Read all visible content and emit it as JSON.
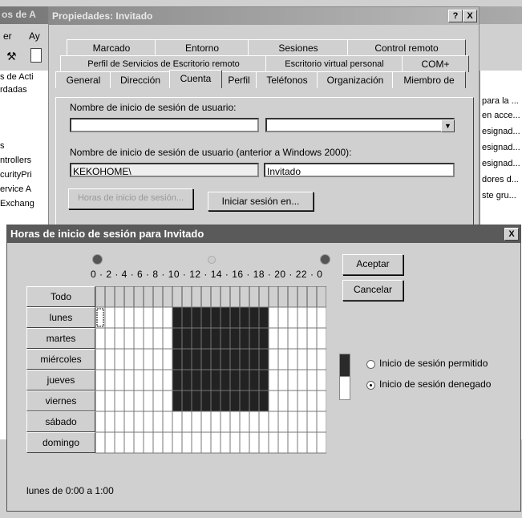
{
  "background_window": {
    "title": "os de A",
    "menu": [
      "er",
      "Ay"
    ],
    "left_items": [
      "s de Acti",
      "rdadas",
      "s",
      "ntrollers",
      "curityPri",
      "ervice A",
      "Exchang"
    ],
    "right_items": [
      "para la ...",
      "en acce...",
      "esignad...",
      "esignad...",
      "esignad...",
      "dores d...",
      "ste gru..."
    ]
  },
  "props_dialog": {
    "title": "Propiedades: Invitado",
    "help_btn": "?",
    "close_btn": "X",
    "tabs_row1": [
      "Marcado",
      "Entorno",
      "Sesiones",
      "Control remoto"
    ],
    "tabs_row2": [
      "Perfil de Servicios de Escritorio remoto",
      "Escritorio virtual personal",
      "COM+"
    ],
    "tabs_row3": [
      "General",
      "Dirección",
      "Cuenta",
      "Perfil",
      "Teléfonos",
      "Organización",
      "Miembro de"
    ],
    "selected_tab": "Cuenta",
    "logon_name_label": "Nombre de inicio de sesión de usuario:",
    "logon_name_value": "",
    "domain_value": "",
    "pre2000_label": "Nombre de inicio de sesión de usuario (anterior a Windows 2000):",
    "pre2000_domain": "KEKOHOME\\",
    "pre2000_name": "Invitado",
    "hours_btn": "Horas de inicio de sesión...",
    "logon_to_btn": "Iniciar sesión en..."
  },
  "hours_dialog": {
    "title": "Horas de inicio de sesión para Invitado",
    "close_btn": "X",
    "hour_labels": "0 · 2 · 4 · 6 · 8 · 10 · 12 · 14 · 16 · 18 · 20 · 22 · 0",
    "all_label": "Todo",
    "days": [
      "lunes",
      "martes",
      "miércoles",
      "jueves",
      "viernes",
      "sábado",
      "domingo"
    ],
    "denied_hours": {
      "start": 8,
      "end": 18,
      "days": [
        "lunes",
        "martes",
        "miércoles",
        "jueves",
        "viernes"
      ]
    },
    "ok_btn": "Aceptar",
    "cancel_btn": "Cancelar",
    "legend_permitted": "Inicio de sesión permitido",
    "legend_denied": "Inicio de sesión denegado",
    "selected_option": "denied",
    "status": "lunes de 0:00 a 1:00"
  }
}
